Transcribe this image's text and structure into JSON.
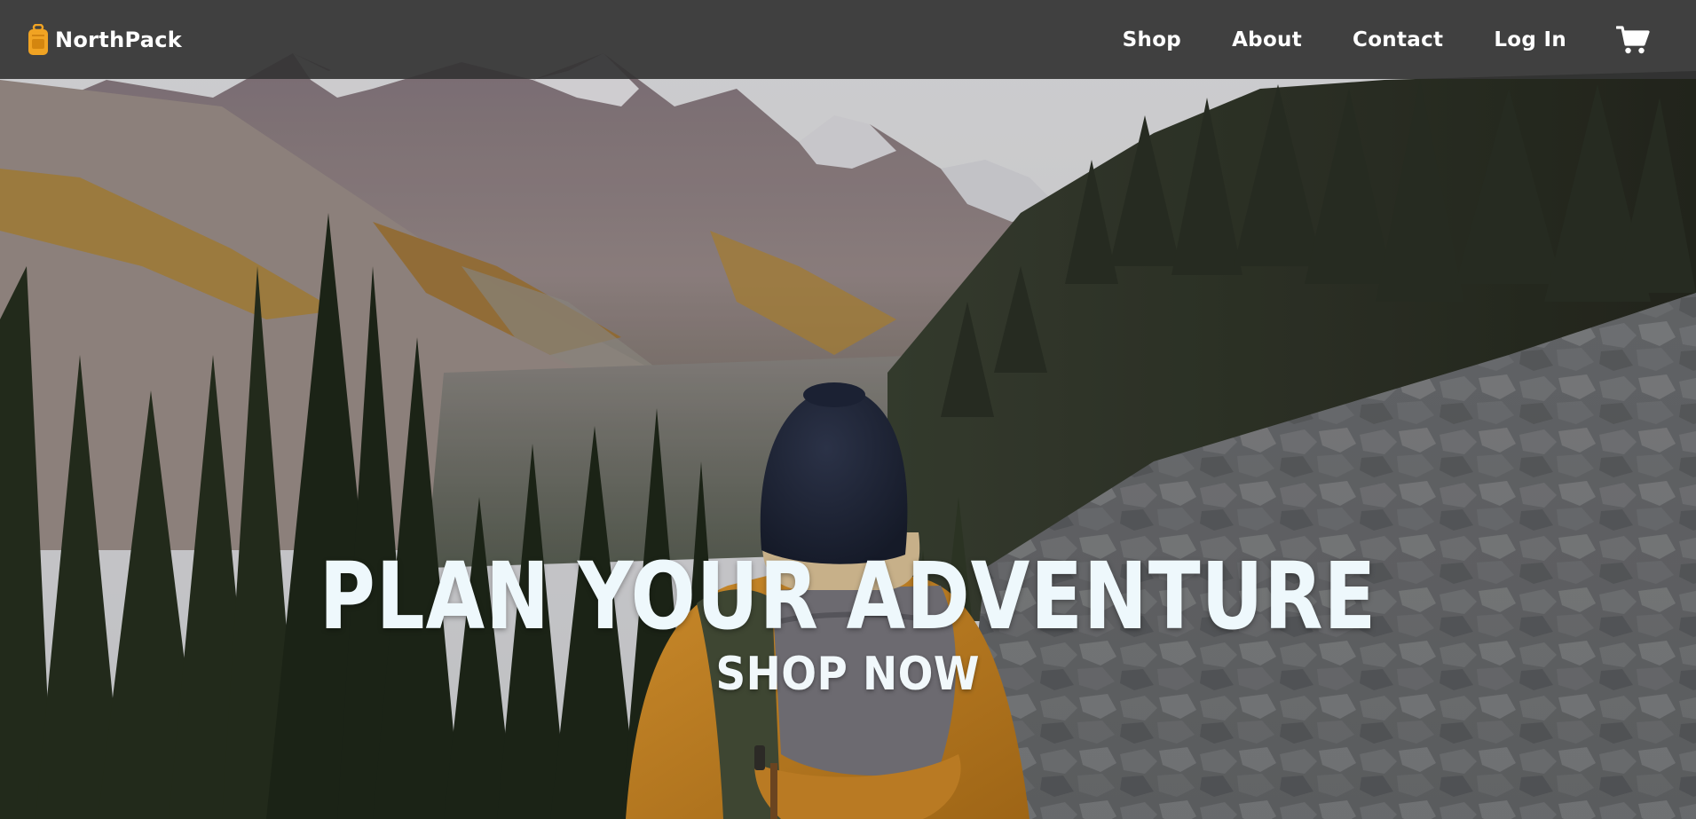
{
  "brand": {
    "name": "NorthPack",
    "logo_icon": "backpack-icon",
    "logo_color": "#f0a323"
  },
  "nav": {
    "links": [
      {
        "label": "Shop"
      },
      {
        "label": "About"
      },
      {
        "label": "Contact"
      },
      {
        "label": "Log In"
      }
    ],
    "cart_icon": "shopping-cart-icon"
  },
  "hero": {
    "title": "PLAN YOUR ADVENTURE",
    "cta_label": "SHOP NOW",
    "background_image": "hiker-in-mountain-valley-photo"
  },
  "colors": {
    "navbar_bg": "#343434",
    "text": "#ffffff",
    "hero_text": "#eef8fc",
    "jacket": "#c98a27"
  }
}
